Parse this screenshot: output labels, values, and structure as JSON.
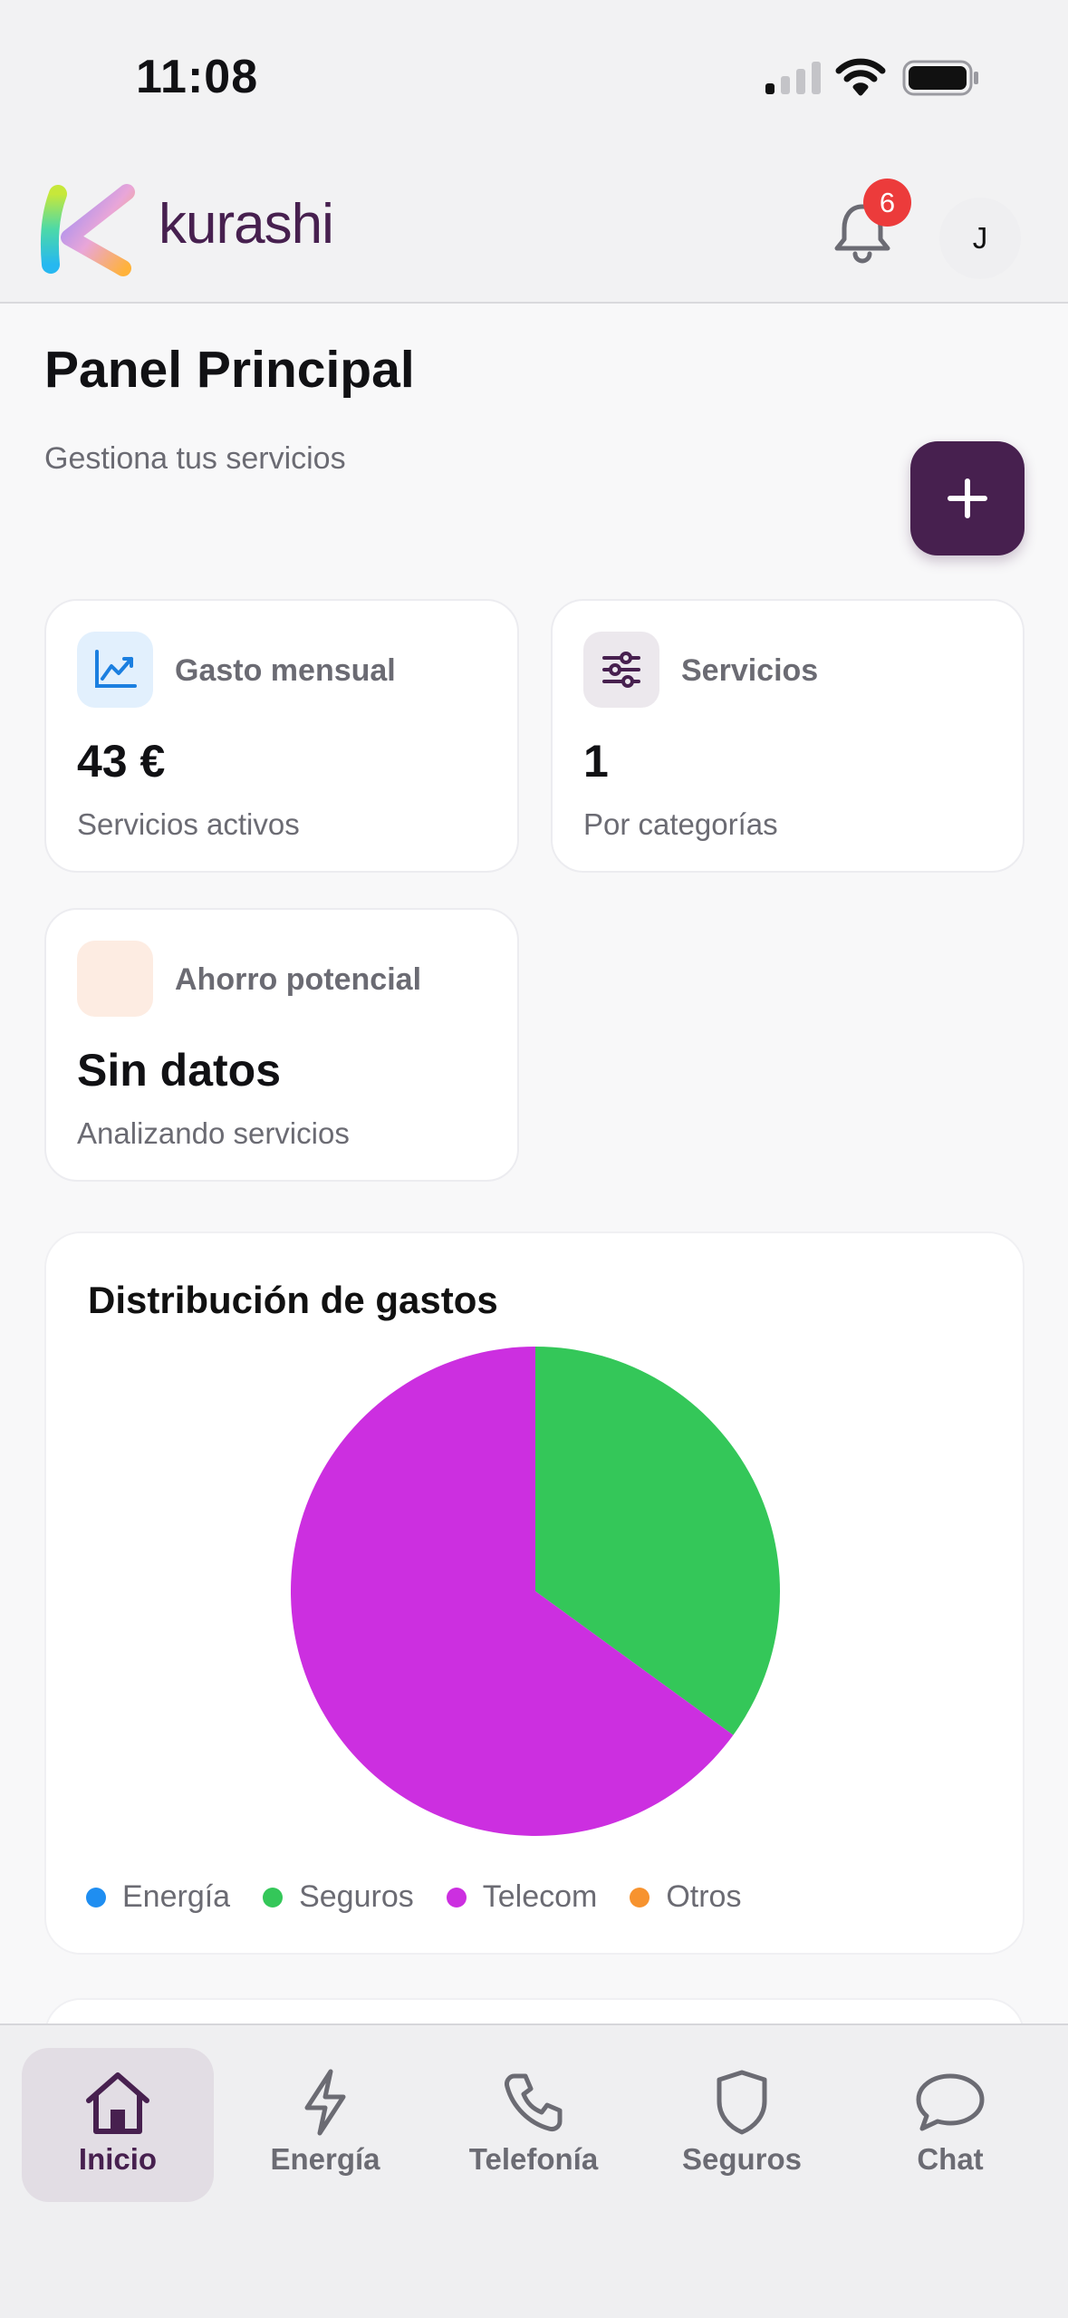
{
  "status_bar": {
    "time": "11:08"
  },
  "header": {
    "brand": "kurashi",
    "notifications_count": "6",
    "avatar_initial": "J"
  },
  "page": {
    "title": "Panel Principal",
    "subtitle": "Gestiona tus servicios"
  },
  "cards": [
    {
      "label": "Gasto mensual",
      "value": "43 €",
      "sub": "Servicios activos",
      "icon": "chart-trend-icon",
      "accent": "#1b7fe0"
    },
    {
      "label": "Servicios",
      "value": "1",
      "sub": "Por categorías",
      "icon": "sliders-icon",
      "accent": "#47204f"
    },
    {
      "label": "Ahorro potencial",
      "value": "Sin datos",
      "sub": "Analizando servicios",
      "icon": "savings-icon",
      "accent": "#f0a36b"
    }
  ],
  "chart": {
    "title": "Distribución de gastos"
  },
  "chart_data": {
    "type": "pie",
    "title": "Distribución de gastos",
    "legend": [
      "Energía",
      "Seguros",
      "Telecom",
      "Otros"
    ],
    "legend_placement": "bottom",
    "series": [
      {
        "name": "Energía",
        "value": 0,
        "color": "#1f8ef1"
      },
      {
        "name": "Seguros",
        "value": 35,
        "color": "#34c759"
      },
      {
        "name": "Telecom",
        "value": 65,
        "color": "#cc2fe0"
      },
      {
        "name": "Otros",
        "value": 0,
        "color": "#f7932f"
      }
    ]
  },
  "tabs": [
    {
      "label": "Inicio",
      "icon": "home-icon",
      "active": true
    },
    {
      "label": "Energía",
      "icon": "bolt-icon",
      "active": false
    },
    {
      "label": "Telefonía",
      "icon": "phone-icon",
      "active": false
    },
    {
      "label": "Seguros",
      "icon": "shield-icon",
      "active": false
    },
    {
      "label": "Chat",
      "icon": "chat-bubble-icon",
      "active": false
    }
  ],
  "colors": {
    "brand": "#47204f",
    "badge": "#ec3b3b",
    "muted_text": "#6b6b73"
  }
}
